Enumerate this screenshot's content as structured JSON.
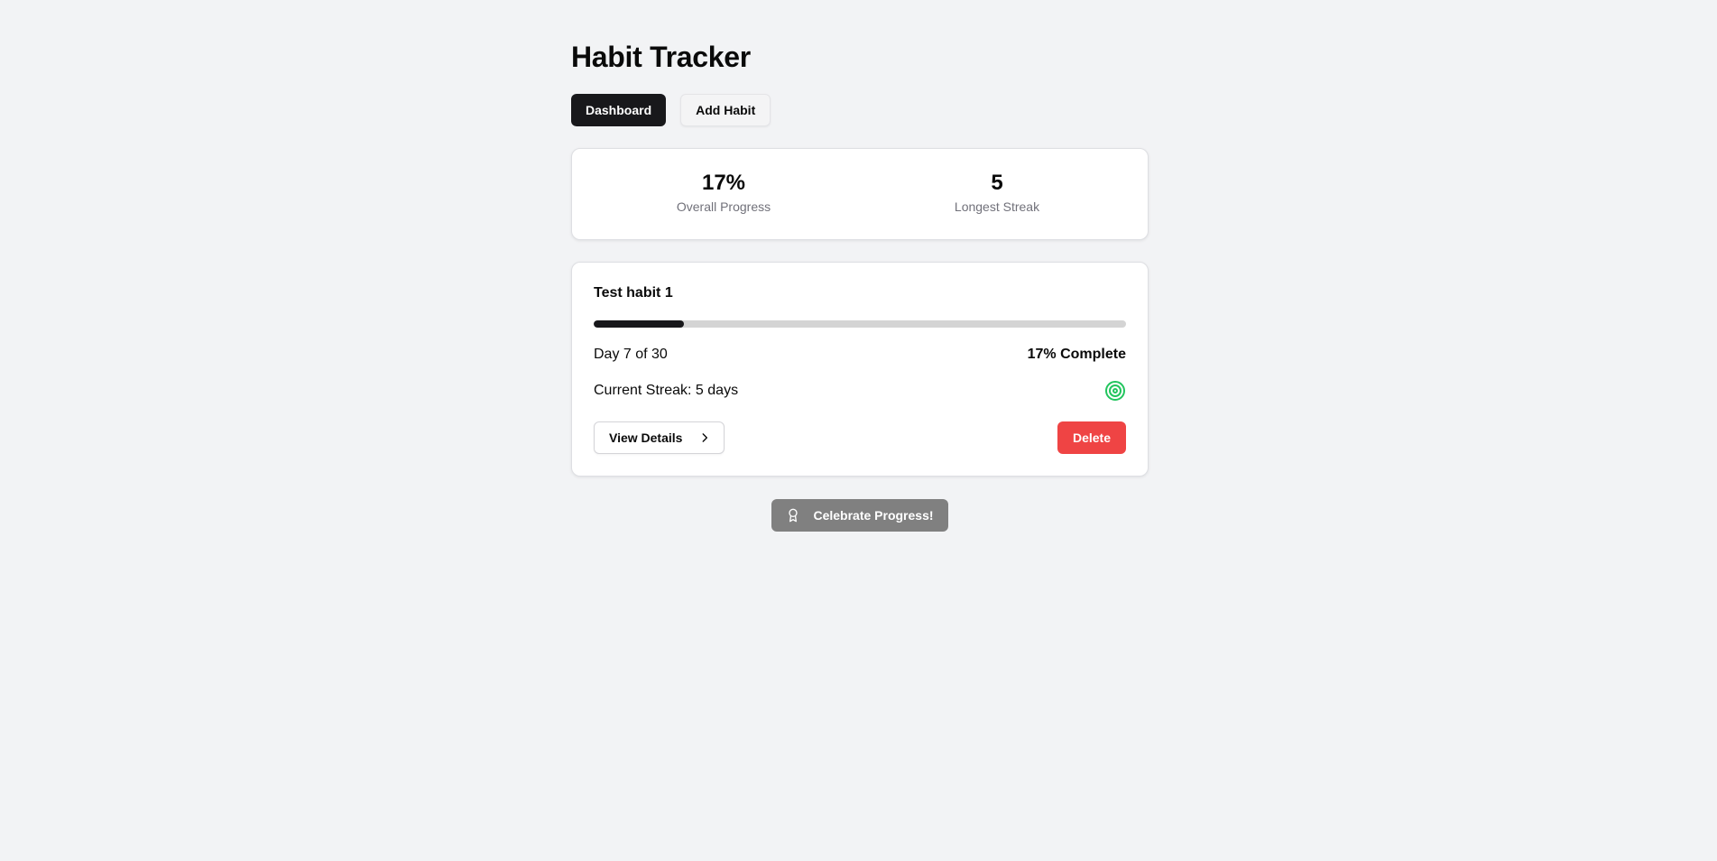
{
  "app": {
    "title": "Habit Tracker"
  },
  "nav": {
    "tabs": [
      {
        "label": "Dashboard",
        "active": true
      },
      {
        "label": "Add Habit",
        "active": false
      }
    ]
  },
  "stats": {
    "overall_progress": {
      "value": "17%",
      "label": "Overall Progress"
    },
    "longest_streak": {
      "value": "5",
      "label": "Longest Streak"
    }
  },
  "habits": [
    {
      "name": "Test habit 1",
      "progress_fraction": 0.17,
      "day_text": "Day 7 of 30",
      "complete_text": "17% Complete",
      "streak_text": "Current Streak: 5 days",
      "status_icon": "target-icon",
      "view_label": "View Details",
      "delete_label": "Delete"
    }
  ],
  "celebrate": {
    "label": "Celebrate Progress!",
    "icon": "award-icon"
  },
  "colors": {
    "background": "#f2f3f5",
    "primary": "#18181b",
    "danger": "#ef4444",
    "success": "#22c55e",
    "disabled": "#808080",
    "track": "#d4d4d4"
  }
}
